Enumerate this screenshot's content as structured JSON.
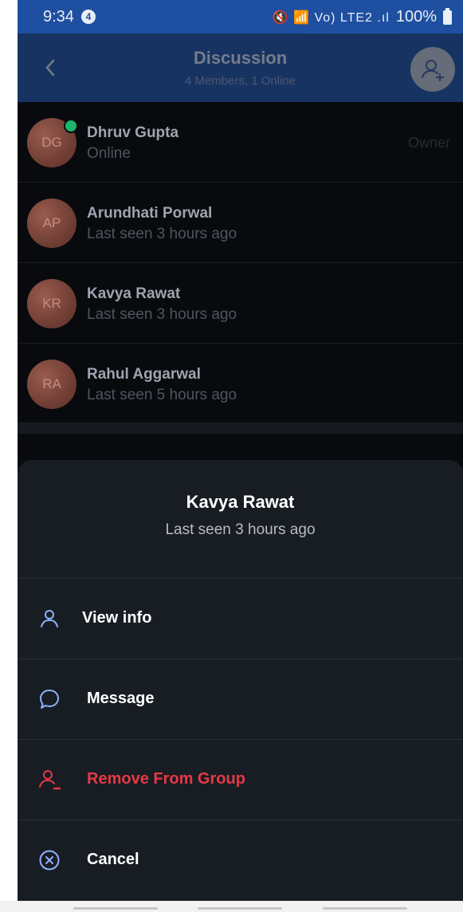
{
  "status_bar": {
    "time": "9:34",
    "notification_count": "4",
    "icons": "🔇 📶 Vo) LTE2 .ıl",
    "battery": "100%"
  },
  "header": {
    "title": "Discussion",
    "subtitle": "4 Members, 1 Online"
  },
  "members": [
    {
      "initials": "DG",
      "name": "Dhruv Gupta",
      "status": "Online",
      "role": "Owner",
      "online": true
    },
    {
      "initials": "AP",
      "name": "Arundhati Porwal",
      "status": "Last seen 3 hours ago",
      "role": "",
      "online": false
    },
    {
      "initials": "KR",
      "name": "Kavya Rawat",
      "status": "Last seen 3 hours ago",
      "role": "",
      "online": false
    },
    {
      "initials": "RA",
      "name": "Rahul Aggarwal",
      "status": "Last seen 5 hours ago",
      "role": "",
      "online": false
    }
  ],
  "sheet": {
    "name": "Kavya Rawat",
    "status": "Last seen 3 hours ago",
    "options": [
      {
        "label": "View info",
        "icon": "person-icon"
      },
      {
        "label": "Message",
        "icon": "message-bubble-icon"
      },
      {
        "label": "Remove From Group",
        "icon": "remove-person-icon",
        "color": "#e53945"
      },
      {
        "label": "Cancel",
        "icon": "cancel-circle-icon"
      }
    ]
  },
  "colors": {
    "accent": "#1f4fa0",
    "danger": "#e53945",
    "online": "#1bb56b",
    "icon_blue": "#8fb2ff"
  }
}
